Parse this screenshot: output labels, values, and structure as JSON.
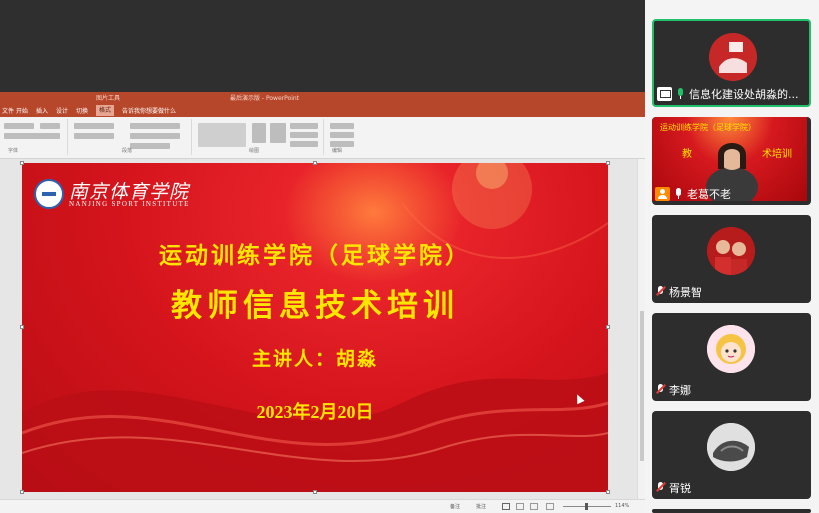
{
  "ppt": {
    "doc_title": "最后演示版 - PowerPoint",
    "context_label": "图片工具",
    "tabs": [
      "文件",
      "开始",
      "插入",
      "设计",
      "切换",
      "动画",
      "放映",
      "审阅",
      "视图",
      "格式"
    ],
    "active_tab": "格式",
    "tell_me": "告诉我你想要做什么",
    "ribbon_groups": [
      "字体",
      "段落",
      "绘图",
      "编辑"
    ],
    "status_notes": "备注",
    "status_comments": "批注",
    "zoom": "114%"
  },
  "slide": {
    "school_cn": "南京体育学院",
    "school_en": "NANJING SPORT INSTITUTE",
    "title_line1": "运动训练学院（足球学院）",
    "title_line2": "教师信息技术培训",
    "speaker": "主讲人：胡淼",
    "date": "2023年2月20日"
  },
  "participants": [
    {
      "name": "信息化建设处胡淼的...",
      "status": "screen-sharing",
      "mic": "active",
      "speaking": true
    },
    {
      "name": "老葛不老",
      "status": "camera-on",
      "mic": "on",
      "speaking": false
    },
    {
      "name": "杨景智",
      "status": "avatar",
      "mic": "muted",
      "speaking": false
    },
    {
      "name": "李娜",
      "status": "avatar",
      "mic": "muted",
      "speaking": false
    },
    {
      "name": "胥锐",
      "status": "avatar",
      "mic": "muted",
      "speaking": false
    }
  ],
  "colors": {
    "slide_red": "#d5141c",
    "title_yellow": "#ffe600",
    "ppt_accent": "#b7472a",
    "speaking_border": "#21c16b",
    "muted_red": "#e53935"
  }
}
